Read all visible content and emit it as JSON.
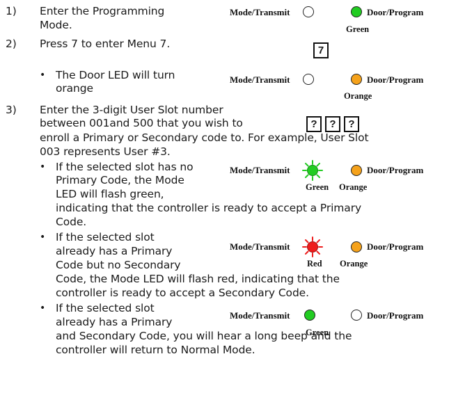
{
  "steps": [
    {
      "num": "1)",
      "lines": [
        "Enter the Programming",
        "Mode."
      ]
    },
    {
      "num": "2)",
      "lines": [
        "Press 7 to enter Menu 7."
      ]
    },
    {
      "num": "3)",
      "lines": [
        "Enter the 3-digit User Slot number",
        "between 001and 500 that you wish to",
        "enroll a Primary or Secondary code to. For example, User Slot",
        "003 represents User #3."
      ]
    }
  ],
  "bullets": [
    {
      "lines": [
        "The Door LED will turn",
        "orange"
      ]
    },
    {
      "lines": [
        "If the selected slot has no",
        "Primary Code, the Mode",
        "LED will flash green,",
        "indicating that the controller is ready to accept a Primary",
        "Code."
      ]
    },
    {
      "lines": [
        "If the selected slot",
        "already has a Primary",
        "Code but no Secondary",
        "Code, the Mode LED will flash red, indicating that the",
        "controller is ready to accept a Secondary Code."
      ]
    },
    {
      "lines": [
        "If the selected slot",
        "already has a Primary",
        "and Secondary Code, you will hear a long beep and the",
        "controller will return to Normal Mode."
      ]
    }
  ],
  "bullet_glyph": "•",
  "labels": {
    "mode": "Mode/Transmit",
    "door": "Door/Program"
  },
  "indicators": [
    {
      "mode_state": "off",
      "door_state": "green",
      "mode_caption": "",
      "door_caption": "Green"
    },
    {
      "mode_state": "off",
      "door_state": "orange",
      "mode_caption": "",
      "door_caption": "Orange"
    },
    {
      "mode_state": "flash-green",
      "door_state": "orange",
      "mode_caption": "Green",
      "door_caption": "Orange"
    },
    {
      "mode_state": "flash-red",
      "door_state": "orange",
      "mode_caption": "Red",
      "door_caption": "Orange"
    },
    {
      "mode_state": "green",
      "door_state": "off",
      "mode_caption": "Green",
      "door_caption": ""
    }
  ],
  "keys": {
    "menu": "7",
    "slot": [
      "?",
      "?",
      "?"
    ]
  },
  "colors": {
    "green": "#22cc22",
    "orange": "#f5a21b",
    "red": "#ee1c1c",
    "off": "#ffffff"
  }
}
